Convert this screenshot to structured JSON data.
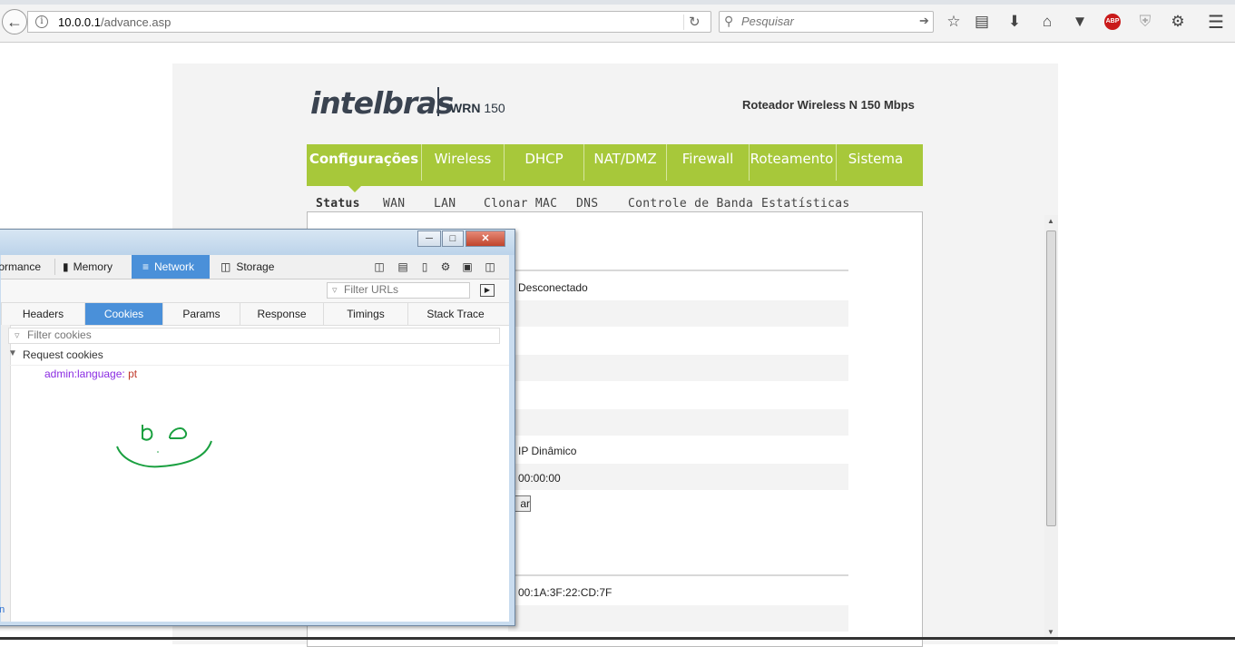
{
  "browser": {
    "url_host": "10.0.0.1",
    "url_path": "/advance.asp",
    "search_placeholder": "Pesquisar",
    "toolbar_icons": [
      "star-icon",
      "reading-list-icon",
      "download-icon",
      "home-icon",
      "pocket-icon",
      "adblock-icon",
      "shield-icon",
      "extension-icon",
      "menu-icon"
    ],
    "adblock_label": "ABP"
  },
  "router": {
    "brand": "intelbras",
    "model_name": "WRN",
    "model_num": "150",
    "tagline": "Roteador Wireless N 150 Mbps",
    "nav": [
      "Configurações",
      "Wireless",
      "DHCP",
      "NAT/DMZ",
      "Firewall",
      "Roteamento",
      "Sistema"
    ],
    "subnav": [
      "Status",
      "WAN",
      "LAN",
      "Clonar MAC",
      "DNS",
      "Controle de Banda",
      "Estatísticas"
    ],
    "content": {
      "status_value": "Desconectado",
      "conn_type": "IP Dinâmico",
      "time": "00:00:00",
      "button_partial": "ar",
      "mac": "00:1A:3F:22:CD:7F"
    },
    "accent": "#a7c83a"
  },
  "devtools": {
    "tabs": [
      "rformance",
      "Memory",
      "Network",
      "Storage"
    ],
    "selected_tab": "Network",
    "filter_urls_placeholder": "Filter URLs",
    "left_fragment": "r",
    "subtabs": [
      "Headers",
      "Cookies",
      "Params",
      "Response",
      "Timings",
      "Stack Trace"
    ],
    "selected_subtab": "Cookies",
    "filter_cookies_placeholder": "Filter cookies",
    "section": "Request cookies",
    "cookie": {
      "name": "admin:language:",
      "value": "pt"
    },
    "bottom_fragment": "on"
  }
}
